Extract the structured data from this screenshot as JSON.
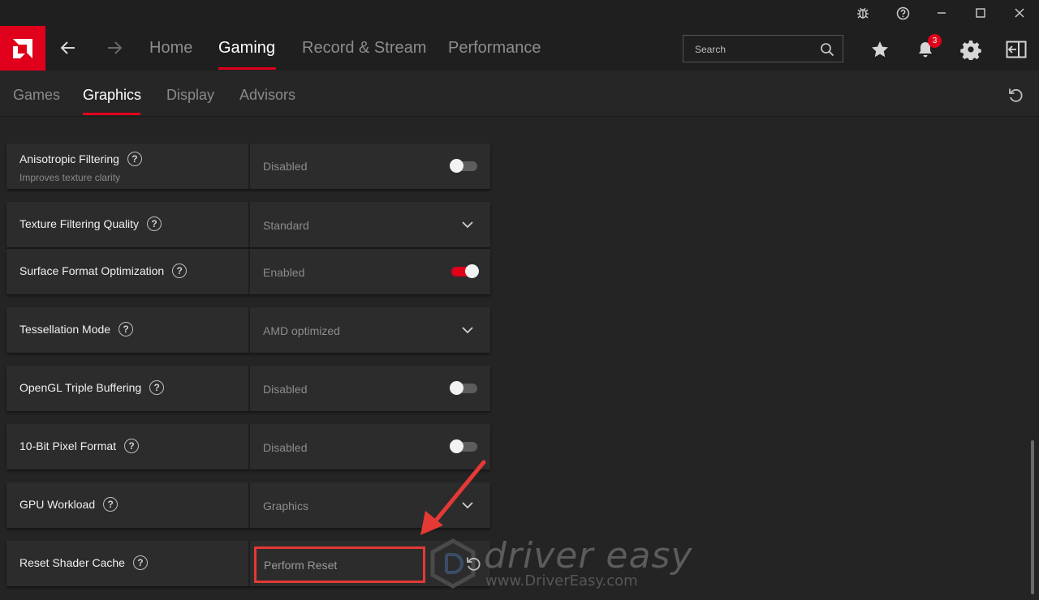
{
  "window": {
    "controls": [
      "bug-icon",
      "help-icon",
      "minimize-icon",
      "maximize-icon",
      "close-icon"
    ]
  },
  "header": {
    "tabs": [
      {
        "label": "Home",
        "active": false
      },
      {
        "label": "Gaming",
        "active": true
      },
      {
        "label": "Record & Stream",
        "active": false
      },
      {
        "label": "Performance",
        "active": false
      }
    ],
    "search_placeholder": "Search",
    "notification_count": "3",
    "accent_color": "#e0001b"
  },
  "subnav": {
    "tabs": [
      {
        "label": "Games",
        "active": false
      },
      {
        "label": "Graphics",
        "active": true
      },
      {
        "label": "Display",
        "active": false
      },
      {
        "label": "Advisors",
        "active": false
      }
    ]
  },
  "settings": [
    {
      "label": "Anisotropic Filtering",
      "sublabel": "Improves texture clarity",
      "value": "Disabled",
      "control": "toggle",
      "on": false
    },
    {
      "label": "Texture Filtering Quality",
      "value": "Standard",
      "control": "dropdown"
    },
    {
      "label": "Surface Format Optimization",
      "value": "Enabled",
      "control": "toggle",
      "on": true
    },
    {
      "label": "Tessellation Mode",
      "value": "AMD optimized",
      "control": "dropdown"
    },
    {
      "label": "OpenGL Triple Buffering",
      "value": "Disabled",
      "control": "toggle",
      "on": false
    },
    {
      "label": "10-Bit Pixel Format",
      "value": "Disabled",
      "control": "toggle",
      "on": false
    },
    {
      "label": "GPU Workload",
      "value": "Graphics",
      "control": "dropdown"
    },
    {
      "label": "Reset Shader Cache",
      "value": "Perform Reset",
      "control": "button"
    }
  ],
  "watermark": {
    "brand": "driver easy",
    "url": "www.DriverEasy.com"
  },
  "annotation": {
    "highlight_color": "#e53935"
  }
}
